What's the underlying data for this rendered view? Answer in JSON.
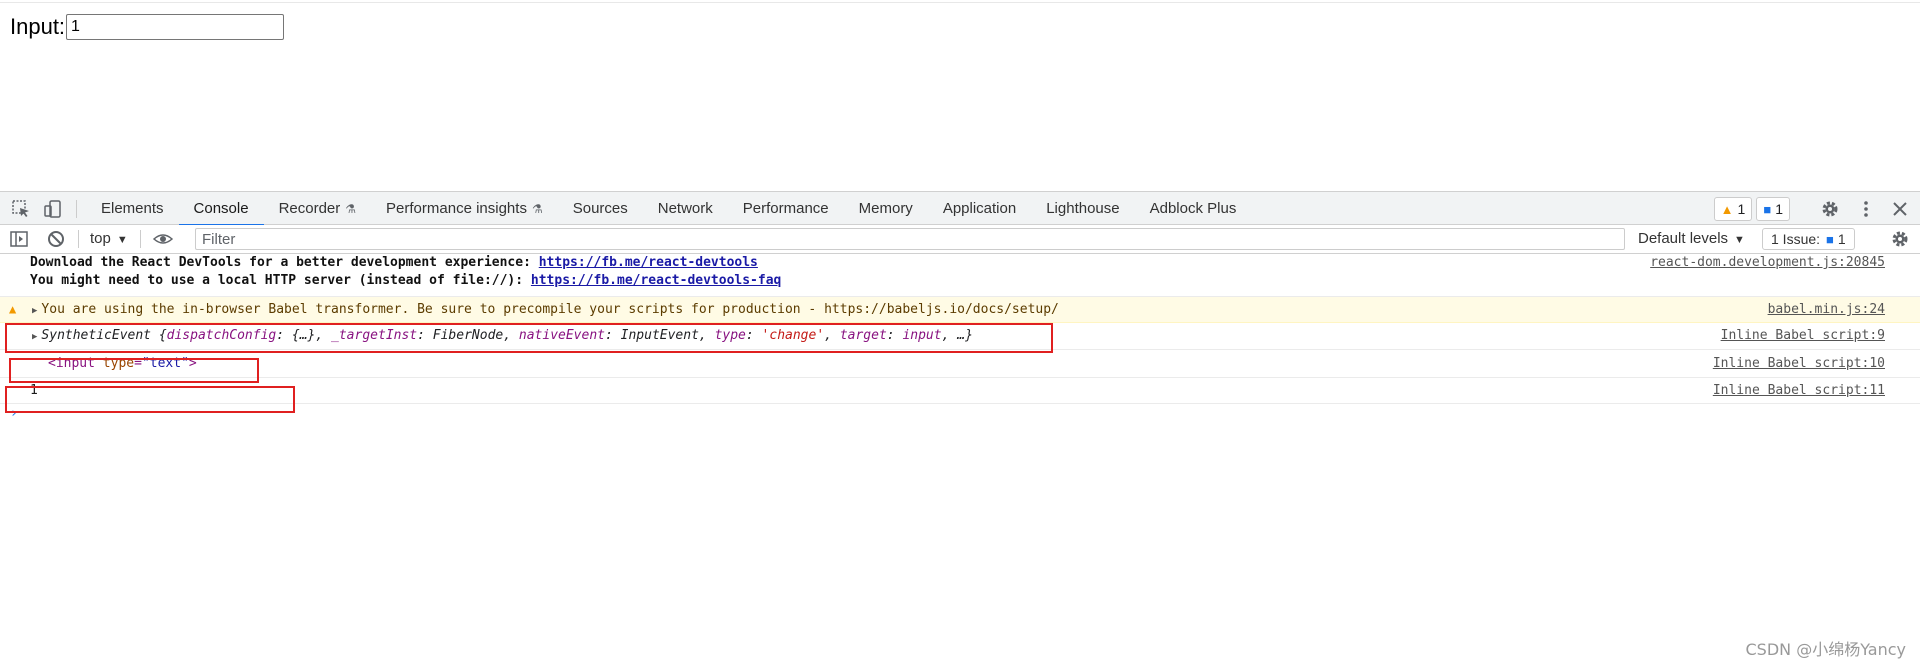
{
  "page": {
    "input_label": "Input:",
    "input_value": "1"
  },
  "devtools": {
    "tabs": [
      {
        "label": "Elements"
      },
      {
        "label": "Console",
        "active": true
      },
      {
        "label": "Recorder",
        "experimental": true
      },
      {
        "label": "Performance insights",
        "experimental": true
      },
      {
        "label": "Sources"
      },
      {
        "label": "Network"
      },
      {
        "label": "Performance"
      },
      {
        "label": "Memory"
      },
      {
        "label": "Application"
      },
      {
        "label": "Lighthouse"
      },
      {
        "label": "Adblock Plus"
      }
    ],
    "warning_count": "1",
    "info_count": "1",
    "filter_bar": {
      "context": "top",
      "filter_placeholder": "Filter",
      "levels": "Default levels",
      "issues_label": "1 Issue:",
      "issues_count": "1"
    },
    "console": {
      "react_line1_text": "Download the React DevTools for a better development experience: ",
      "react_line1_link": "https://fb.me/react-devtools",
      "react_line2_text": "You might need to use a local HTTP server (instead of file://): ",
      "react_line2_link": "https://fb.me/react-devtools-faq",
      "react_source": "react-dom.development.js:20845",
      "warn_text": "You are using the in-browser Babel transformer. Be sure to precompile your scripts for production - https://babeljs.io/docs/setup/",
      "warn_source": "babel.min.js:24",
      "event": {
        "name": "SyntheticEvent",
        "k1": "dispatchConfig",
        "v1": "{…}",
        "k2": "_targetInst",
        "v2": "FiberNode",
        "k3": "nativeEvent",
        "v3": "InputEvent",
        "k4": "type",
        "v4": "'change'",
        "k5": "target",
        "v5": "input",
        "rest": "…"
      },
      "event_source": "Inline Babel script:9",
      "element_tag": "input",
      "element_attr_name": "type",
      "element_attr_value": "\"text\"",
      "element_source": "Inline Babel script:10",
      "value_text": "1",
      "value_source": "Inline Babel script:11",
      "prompt": "›"
    }
  },
  "watermark": "CSDN @小绵杨Yancy",
  "colors": {
    "highlight": "#e02020",
    "active_tab_underline": "#1a73e8",
    "warning_bg": "#fffbe5"
  }
}
